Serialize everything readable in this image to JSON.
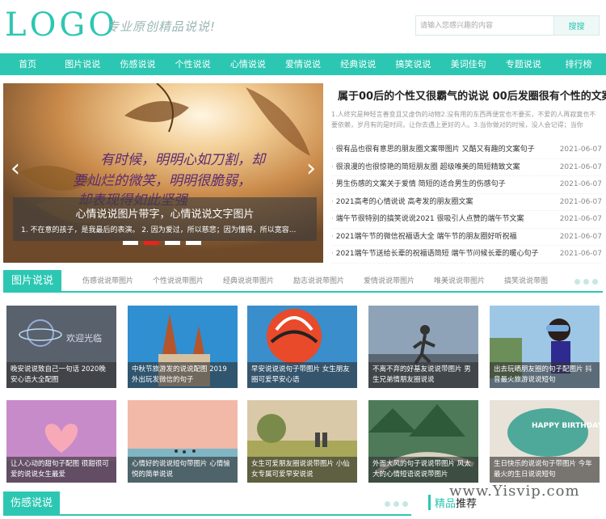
{
  "header": {
    "logo": "LOGO",
    "slogan": "专业原创精品说说!",
    "search_placeholder": "请输入您感兴趣的内容",
    "search_button": "搜搜"
  },
  "nav": [
    "首页",
    "图片说说",
    "伤感说说",
    "个性说说",
    "心情说说",
    "爱情说说",
    "经典说说",
    "搞笑说说",
    "美词佳句",
    "专题说说",
    "排行榜"
  ],
  "slider": {
    "overlay_title": "心情说说图片带字，心情说说文字图片",
    "overlay_desc": "1. 不在意的孩子，是我最后的表演。 2. 因为爱过，所以慈悲；因为懂得，所以宽容...",
    "handwriting": "有时候，明明心如刀割，却要灿烂的微笑，明明很脆弱，却表现得如此坚强",
    "arrow_left": "‹",
    "arrow_right": "›"
  },
  "headline": {
    "title": "属于00后的个性又很霸气的说说 00后发圈很有个性的文案",
    "subtitle": "1.人终究是种轻言善变且又虚伪的动物2.没有用的东西再便宜也不要买，不爱的人再寂寞也不要依赖，岁月有的是时间，让你去遇上更好的人。3.当你做对的时候，没人会记得；当你"
  },
  "news": [
    {
      "title": "很有品也很有意思的朋友圈文案带图片 又酷又有趣的文案句子",
      "date": "2021-06-07"
    },
    {
      "title": "很浪漫的也很惊艳的简短朋友圈 超级唯美的简短精致文案",
      "date": "2021-06-07"
    },
    {
      "title": "男生伤感的文案关于爱情 简短的适合男生的伤感句子",
      "date": "2021-06-07"
    },
    {
      "title": "2021高考的心情说说 高考发的朋友圈文案",
      "date": "2021-06-07"
    },
    {
      "title": "端午节很特别的搞笑说说2021 很吸引人点赞的端午节文案",
      "date": "2021-06-07"
    },
    {
      "title": "2021端午节的微信祝福语大全 端午节的朋友圈好听祝福",
      "date": "2021-06-07"
    },
    {
      "title": "2021端午节送给长辈的祝福语简短 端午节问候长辈的暖心句子",
      "date": "2021-06-07"
    }
  ],
  "picture_section": {
    "tag": "图片说说",
    "tabs": [
      "伤感说说带图片",
      "个性说说带图片",
      "经典说说带图片",
      "励志说说带图片",
      "爱情说说带图片",
      "唯美说说带图片",
      "搞笑说说带图"
    ]
  },
  "cards": [
    {
      "caption": "晚安说说致自己一句话 2020晚安心语大全配图",
      "art": "欢迎光临"
    },
    {
      "caption": "中秋节旅游发的说说配图 2019外出玩发微信的句子"
    },
    {
      "caption": "早安说说说句子带图片 女生朋友圈可爱早安心语"
    },
    {
      "caption": "不离不弃的好基友说说带图片 男生兄弟情朋友圈说说"
    },
    {
      "caption": "出去玩晒朋友圈的句子配图片 抖音最火旅游说说短句"
    },
    {
      "caption": "让人心动的甜句子配图 很甜很可爱的说说女生最爱"
    },
    {
      "caption": "心情好的说说短句带图片 心情愉悦的简单说说"
    },
    {
      "caption": "女生可爱朋友圈说说带图片 小仙女专属可爱早安说说"
    },
    {
      "caption": "外面大风的句子说说带图片 风太大的心情短语说说带图片"
    },
    {
      "caption": "生日快乐的说说句子带图片 今年最火的生日说说短句",
      "art": "HAPPY BIRTHDAY EUNBI"
    }
  ],
  "bottom": {
    "tag": "伤感说说",
    "pick_a": "精品",
    "pick_b": "推荐",
    "watermark": "www.Yisvip.com"
  },
  "colors": {
    "accent": "#2cc7b2",
    "active_dot": "#e8231e"
  }
}
